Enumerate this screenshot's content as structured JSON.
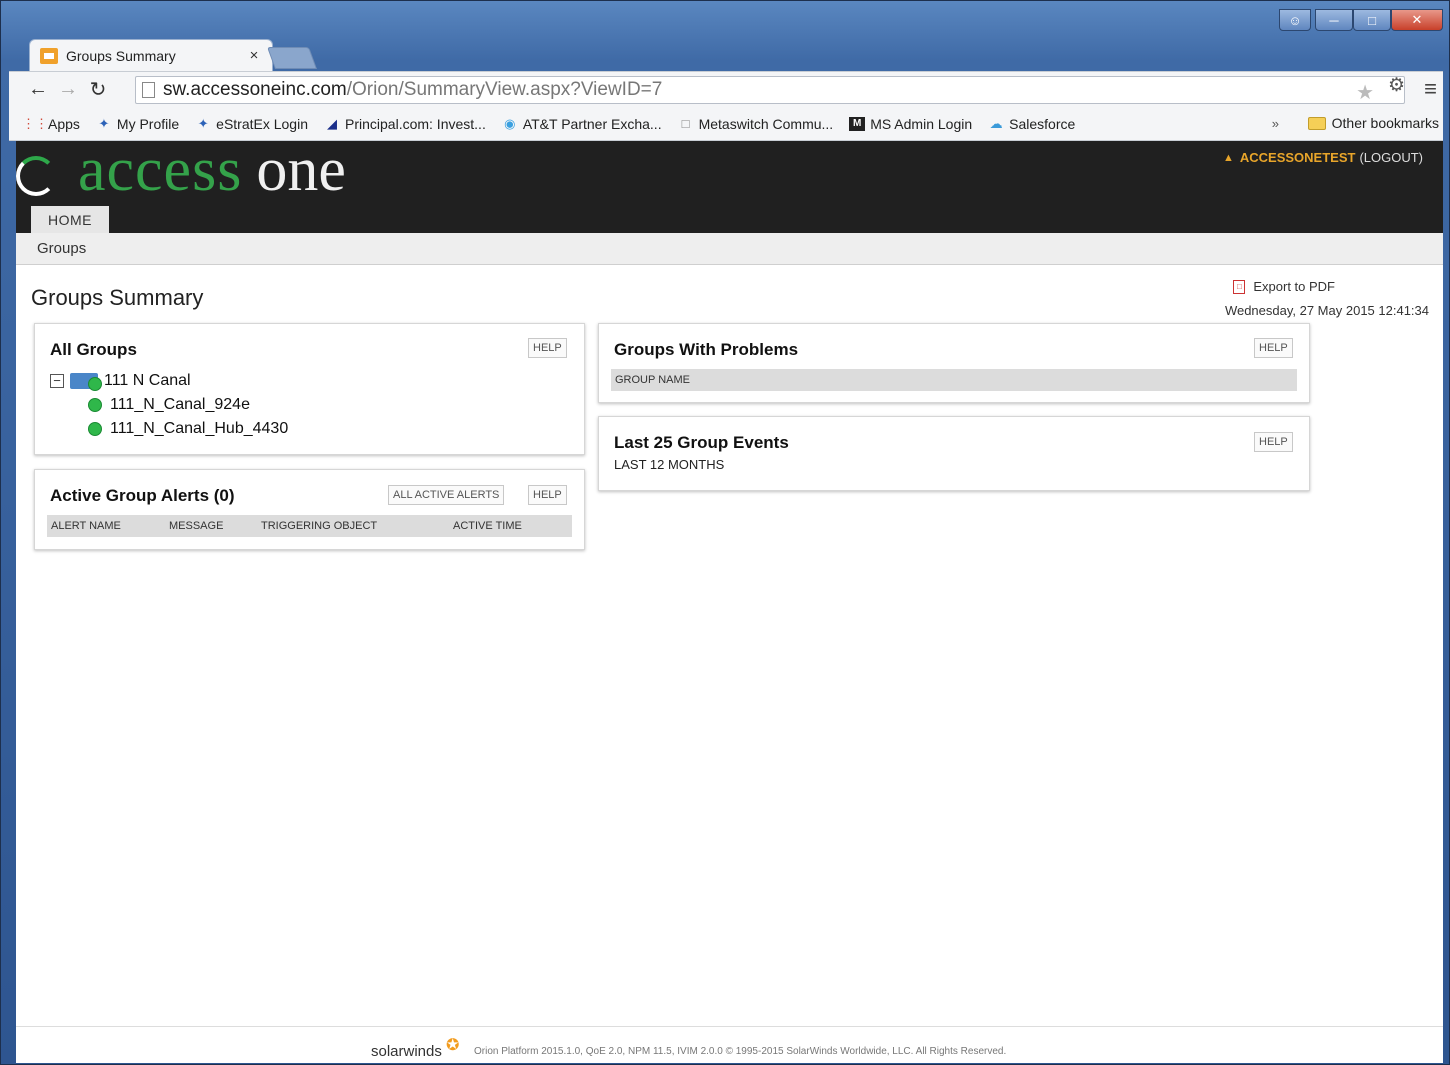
{
  "browser": {
    "tab_title": "Groups Summary",
    "tab_close": "×",
    "url_domain": "sw.accessoneinc.com",
    "url_path": "/Orion/SummaryView.aspx?ViewID=7",
    "bookmarks": [
      {
        "label": "Apps",
        "icon": "apps-grid-icon"
      },
      {
        "label": "My Profile",
        "icon": "estratex-icon"
      },
      {
        "label": "eStratEx Login",
        "icon": "estratex-icon"
      },
      {
        "label": "Principal.com: Invest...",
        "icon": "principal-icon"
      },
      {
        "label": "AT&T Partner Excha...",
        "icon": "att-globe-icon"
      },
      {
        "label": "Metaswitch Commu...",
        "icon": "page-icon"
      },
      {
        "label": "MS Admin Login",
        "icon": "ms-icon"
      },
      {
        "label": "Salesforce",
        "icon": "cloud-icon"
      }
    ],
    "bookmarks_overflow": "»",
    "other_bookmarks": "Other bookmarks"
  },
  "header": {
    "logo_access": "access",
    "logo_one": "one",
    "username": "ACCESSONETEST",
    "logout": "(LOGOUT)",
    "home_tab": "HOME",
    "subnav_item": "Groups"
  },
  "main": {
    "title": "Groups Summary",
    "export_label": "Export to PDF",
    "timestamp": "Wednesday, 27 May 2015 12:41:34"
  },
  "panels": {
    "all_groups": {
      "title": "All Groups",
      "help": "HELP",
      "toggle": "−",
      "root": "111 N Canal",
      "children": [
        "111_N_Canal_924e",
        "111_N_Canal_Hub_4430"
      ]
    },
    "alerts": {
      "title": "Active Group Alerts (0)",
      "all_active_alerts": "ALL ACTIVE ALERTS",
      "help": "HELP",
      "columns": [
        "ALERT NAME",
        "MESSAGE",
        "TRIGGERING OBJECT",
        "ACTIVE TIME"
      ]
    },
    "problems": {
      "title": "Groups With Problems",
      "help": "HELP",
      "columns": [
        "GROUP NAME"
      ]
    },
    "events": {
      "title": "Last 25 Group Events",
      "subtitle": "LAST 12 MONTHS",
      "help": "HELP"
    }
  },
  "footer": {
    "brand": "solarwinds",
    "text": "Orion Platform 2015.1.0, QoE 2.0, NPM 11.5, IVIM 2.0.0 © 1995-2015 SolarWinds Worldwide, LLC. All Rights Reserved."
  },
  "colors": {
    "brand_green": "#34a24a",
    "header_bg": "#202020",
    "user_orange": "#e8a52a",
    "status_green": "#2fb74a"
  }
}
